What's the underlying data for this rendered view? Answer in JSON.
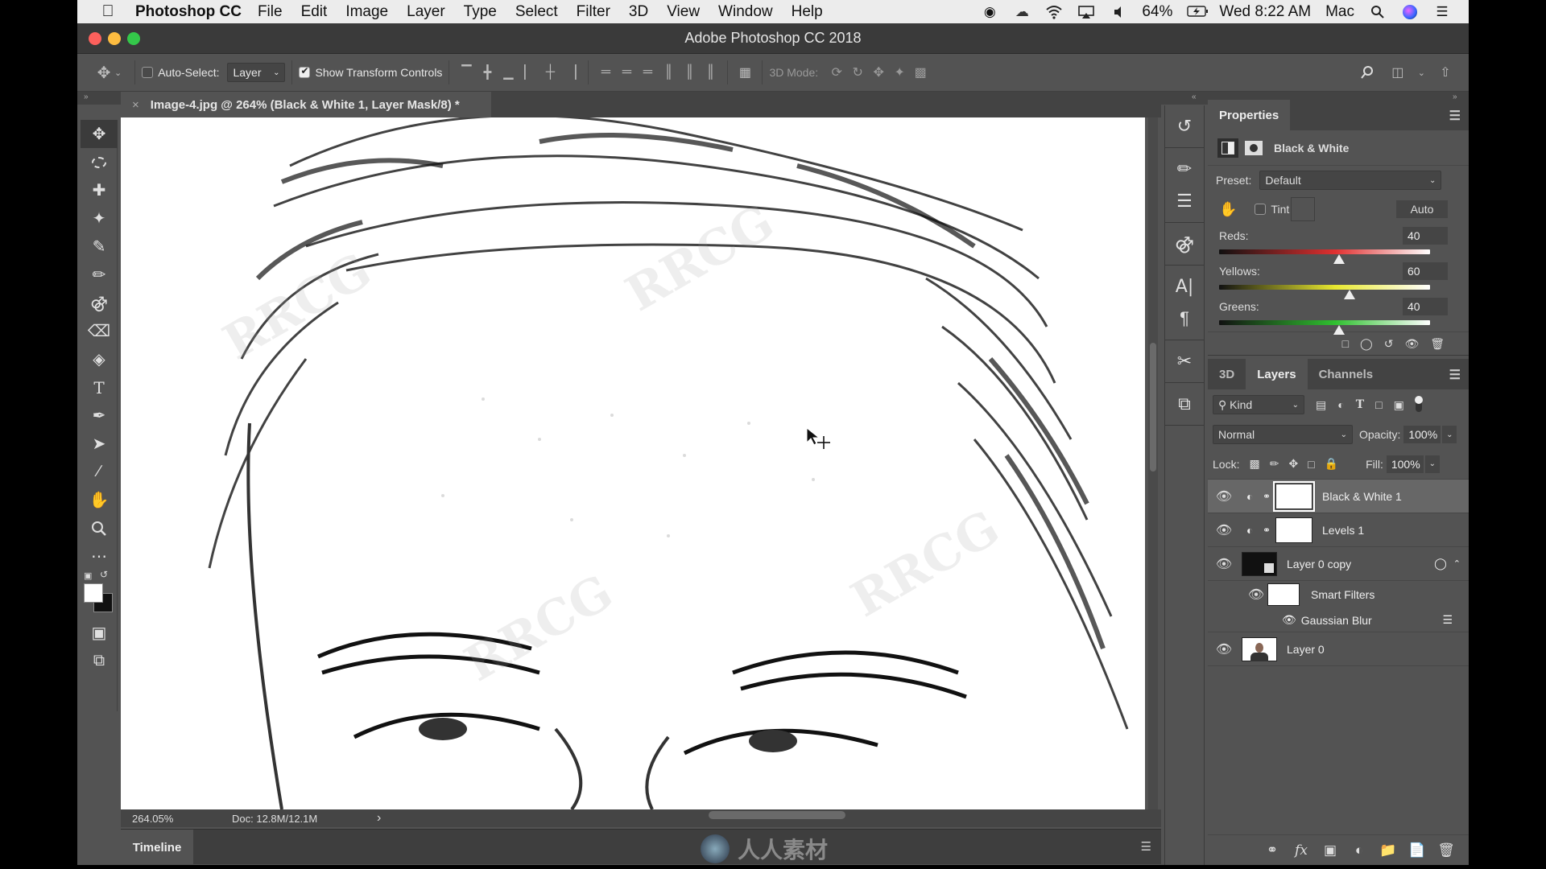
{
  "menubar": {
    "apple": "",
    "app": "Photoshop CC",
    "items": [
      "File",
      "Edit",
      "Image",
      "Layer",
      "Type",
      "Select",
      "Filter",
      "3D",
      "View",
      "Window",
      "Help"
    ],
    "status_icons": [
      "record-icon",
      "creative-cloud-icon",
      "wifi-icon",
      "airplay-icon",
      "volume-icon"
    ],
    "battery": "64%",
    "clock": "Wed 8:22 AM",
    "user": "Mac"
  },
  "window": {
    "title": "Adobe Photoshop CC 2018",
    "traffic_colors": {
      "close": "#fc605c",
      "minimize": "#fdbc40",
      "zoom": "#34c84a"
    }
  },
  "options_bar": {
    "auto_select_label": "Auto-Select:",
    "auto_select_checked": false,
    "auto_select_target": "Layer",
    "show_transform_label": "Show Transform Controls",
    "show_transform_checked": true,
    "mode_3d_label": "3D Mode:"
  },
  "document": {
    "tab_title": "Image-4.jpg @ 264% (Black & White 1, Layer Mask/8) *",
    "zoom": "264.05%",
    "doc_size": "Doc: 12.8M/12.1M",
    "status_arrow": "›"
  },
  "timeline": {
    "label": "Timeline"
  },
  "watermark": {
    "brand": "人人素材",
    "text": "RRCG"
  },
  "properties": {
    "tab": "Properties",
    "adjustment_title": "Black & White",
    "preset_label": "Preset:",
    "preset_value": "Default",
    "tint_label": "Tint",
    "tint_checked": false,
    "auto_label": "Auto",
    "sliders": [
      {
        "label": "Reds:",
        "value": "40",
        "fraction": 0.57,
        "color": "#e03030"
      },
      {
        "label": "Yellows:",
        "value": "60",
        "fraction": 0.62,
        "color": "#e8e830"
      },
      {
        "label": "Greens:",
        "value": "40",
        "fraction": 0.57,
        "color": "#30c030"
      }
    ]
  },
  "layers_panel": {
    "tabs": [
      "3D",
      "Layers",
      "Channels"
    ],
    "active_tab": "Layers",
    "filter_label": "Kind",
    "blend_mode": "Normal",
    "opacity_label": "Opacity:",
    "opacity": "100%",
    "lock_label": "Lock:",
    "fill_label": "Fill:",
    "fill": "100%",
    "layers": [
      {
        "name": "Black & White 1",
        "type": "adjustment",
        "selected": true
      },
      {
        "name": "Levels 1",
        "type": "adjustment",
        "selected": false
      },
      {
        "name": "Layer 0 copy",
        "type": "smart-object",
        "selected": false
      },
      {
        "name": "Smart Filters",
        "type": "smart-filters",
        "selected": false
      },
      {
        "name": "Gaussian Blur",
        "type": "filter",
        "selected": false
      },
      {
        "name": "Layer 0",
        "type": "pixel",
        "selected": false
      }
    ]
  }
}
